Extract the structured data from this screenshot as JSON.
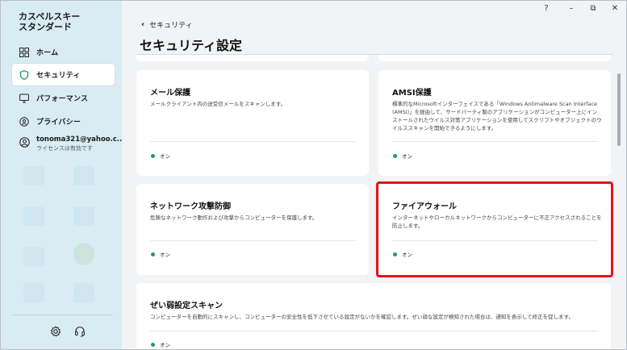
{
  "app": {
    "title": "カスペルスキー\nスタンダード"
  },
  "sidebar": {
    "items": [
      {
        "label": "ホーム",
        "icon": "grid-icon"
      },
      {
        "label": "セキュリティ",
        "icon": "shield-icon"
      },
      {
        "label": "パフォーマンス",
        "icon": "monitor-icon"
      },
      {
        "label": "プライバシー",
        "icon": "privacy-icon"
      }
    ],
    "user": {
      "email": "tonoma321@yahoo.c...",
      "status": "ライセンスは有効です"
    }
  },
  "window_controls": {
    "help": "?",
    "minimize": "–",
    "restore": "⧉",
    "close": "✕"
  },
  "header": {
    "back_label": "セキュリティ",
    "title": "セキュリティ設定"
  },
  "cards": [
    {
      "title": "メール保護",
      "desc": "メールクライアント内の送受信メールをスキャンします。",
      "status": "オン"
    },
    {
      "title": "AMSI保護",
      "desc": "標準的なMicrosoftインターフェイスである「Windows Antimalware Scan Interface (AMSI)」を経由して、サードパーティ製のアプリケーションがコンピューター上にインストールされたウイルス対策アプリケーションを使用してスクリプトやオブジェクトのウイルススキャンを開始できるようにします。",
      "status": "オン"
    },
    {
      "title": "ネットワーク攻撃防御",
      "desc": "危険なネットワーク動作および攻撃からコンピューターを保護します。",
      "status": "オン"
    },
    {
      "title": "ファイアウォール",
      "desc": "インターネットやローカルネットワークからコンピューターに不正アクセスされることを防止します。",
      "status": "オン"
    },
    {
      "title": "ぜい弱設定スキャン",
      "desc": "コンピューターを自動的にスキャンし、コンピューターの安全性を低下させている設定がないかを確認します。ぜい弱な設定が検知された場合は、通知を表示して修正を促します。",
      "status": "オン"
    }
  ],
  "colors": {
    "sidebar_bg": "#d9ecf4",
    "status_on": "#1d9a6c",
    "highlight": "#e3141a"
  }
}
